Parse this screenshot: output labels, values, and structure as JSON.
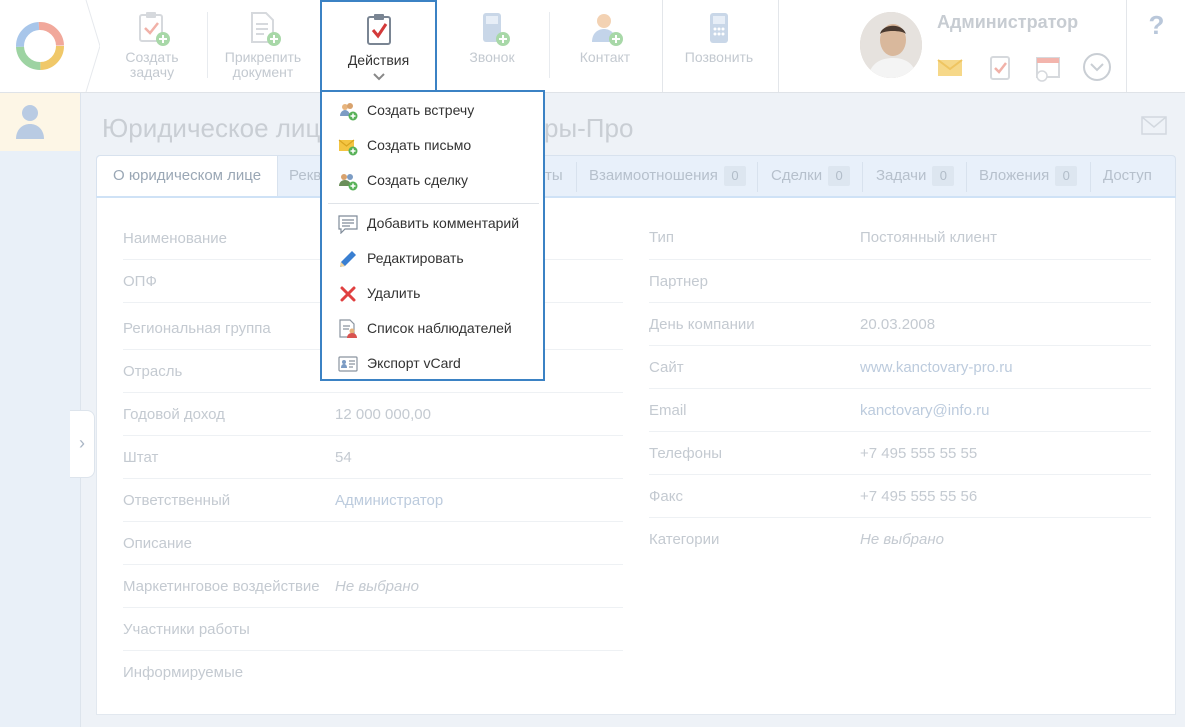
{
  "toolbar": {
    "create_task": "Создать\nзадачу",
    "attach_document": "Прикрепить\nдокумент",
    "actions": "Действия",
    "call": "Звонок",
    "contact": "Контакт",
    "dial": "Позвонить"
  },
  "user": {
    "name": "Администратор",
    "help": "?"
  },
  "page": {
    "title_start": "Юридическое лиц",
    "title_end": "ры-Про"
  },
  "tabs": [
    {
      "label": "О юридическом лице"
    },
    {
      "label": "Рекв"
    },
    {
      "label": "ты"
    },
    {
      "label": "Взаимоотношения",
      "count": "0"
    },
    {
      "label": "Сделки",
      "count": "0"
    },
    {
      "label": "Задачи",
      "count": "0"
    },
    {
      "label": "Вложения",
      "count": "0"
    },
    {
      "label": "Доступ"
    }
  ],
  "left_fields": [
    {
      "label": "Наименование",
      "value": ""
    },
    {
      "label": "ОПФ",
      "value": ""
    },
    {
      "label": "Региональная группа",
      "value": ""
    },
    {
      "label": "Отрасль",
      "value": ""
    },
    {
      "label": "Годовой доход",
      "value": "12 000 000,00"
    },
    {
      "label": "Штат",
      "value": "54"
    },
    {
      "label": "Ответственный",
      "value": "Администратор"
    },
    {
      "label": "Описание",
      "value": ""
    },
    {
      "label": "Маркетинговое воздействие",
      "value": "Не выбрано"
    },
    {
      "label": "Участники работы",
      "value": ""
    },
    {
      "label": "Информируемые",
      "value": ""
    }
  ],
  "right_fields": [
    {
      "label": "Тип",
      "value": "Постоянный клиент"
    },
    {
      "label": "Партнер",
      "value": ""
    },
    {
      "label": "День компании",
      "value": "20.03.2008"
    },
    {
      "label": "Сайт",
      "value": "www.kanctovary-pro.ru"
    },
    {
      "label": "Email",
      "value": "kanctovary@info.ru"
    },
    {
      "label": "Телефоны",
      "value": "+7 495 555 55 55"
    },
    {
      "label": "Факс",
      "value": "+7 495 555 55 56"
    },
    {
      "label": "Категории",
      "value": "Не выбрано"
    }
  ],
  "dropdown": {
    "items": [
      {
        "label": "Создать встречу",
        "icon": "meeting-add-icon"
      },
      {
        "label": "Создать письмо",
        "icon": "letter-add-icon"
      },
      {
        "label": "Создать сделку",
        "icon": "deal-add-icon"
      },
      {
        "label": "Добавить комментарий",
        "icon": "comment-icon"
      },
      {
        "label": "Редактировать",
        "icon": "pencil-icon"
      },
      {
        "label": "Удалить",
        "icon": "delete-icon"
      },
      {
        "label": "Список наблюдателей",
        "icon": "watchers-icon"
      },
      {
        "label": "Экспорт vCard",
        "icon": "vcard-icon"
      }
    ]
  },
  "colors": {
    "accent": "#3b82c4",
    "delete": "#e04040",
    "faded": "#c4cad1"
  }
}
